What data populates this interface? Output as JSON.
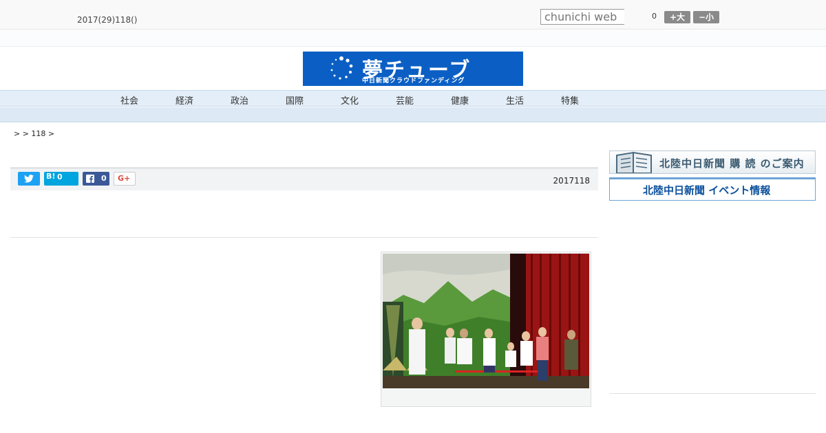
{
  "header": {
    "date": "2017(29)118()",
    "search_placeholder": "chunichi web",
    "font_size_count": "0",
    "font_up_label": "+大",
    "font_down_label": "−小"
  },
  "logo": {
    "title": "夢チューブ",
    "subtitle": "中日新聞クラウドファンディング",
    "color": "#0b5fc4"
  },
  "nav": {
    "items": [
      "社会",
      "経済",
      "政治",
      "国際",
      "文化",
      "芸能",
      "健康",
      "生活",
      "特集"
    ]
  },
  "breadcrumb": "> > 118 >",
  "share": {
    "twitter_icon": "twitter-icon",
    "hatena_label": "B!",
    "hatena_count": "0",
    "facebook_count": "0",
    "gplus_label": "G+"
  },
  "article": {
    "date": "2017118"
  },
  "sidebar": {
    "subscription_banner": "北陸中日新聞 購 読 のご案内",
    "event_banner": "北陸中日新聞 イベント情報"
  }
}
